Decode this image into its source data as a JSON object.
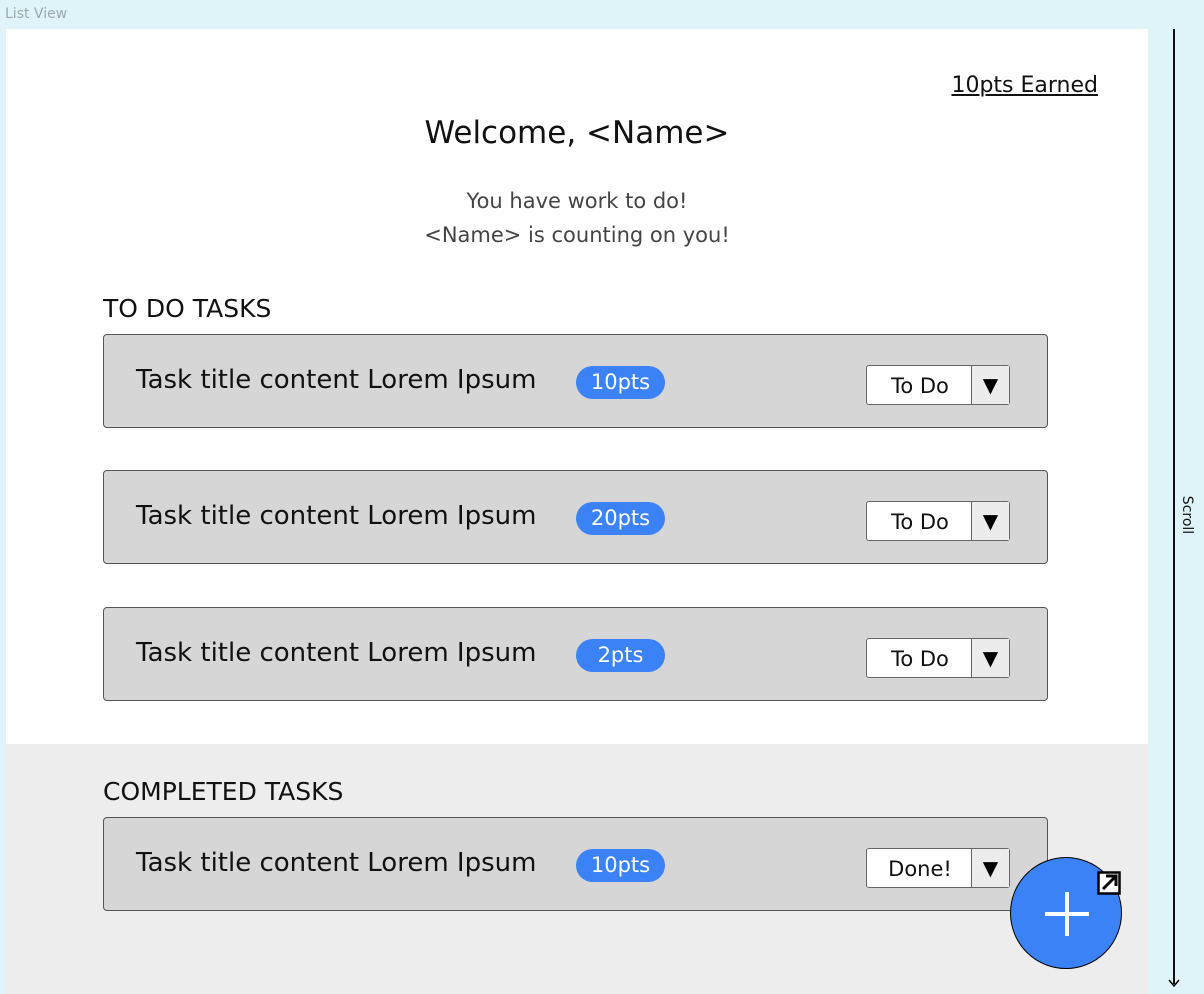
{
  "frame": {
    "label": "List View"
  },
  "header": {
    "points_earned": "10pts Earned",
    "welcome": "Welcome, <Name>",
    "subtext_line1": "You have work to do!",
    "subtext_line2": "<Name> is counting on you!"
  },
  "todo": {
    "title": "TO DO TASKS",
    "tasks": [
      {
        "title": "Task title content Lorem Ipsum",
        "points": "10pts",
        "status": "To Do"
      },
      {
        "title": "Task title content Lorem Ipsum",
        "points": "20pts",
        "status": "To Do"
      },
      {
        "title": "Task title content Lorem Ipsum",
        "points": "2pts",
        "status": "To Do"
      }
    ]
  },
  "completed": {
    "title": "COMPLETED TASKS",
    "tasks": [
      {
        "title": "Task title content Lorem Ipsum",
        "points": "10pts",
        "status": "Done!"
      }
    ]
  },
  "scroll": {
    "label": "Scroll"
  },
  "icons": {
    "caret": "caret-down-icon",
    "fab": "plus-icon",
    "expand": "expand-icon",
    "scroll_arrow": "arrow-down-icon"
  },
  "colors": {
    "accent": "#3b82f6",
    "card": "#d6d6d6",
    "completed_bg": "#ededed",
    "frame_bg": "#dff4f8"
  }
}
